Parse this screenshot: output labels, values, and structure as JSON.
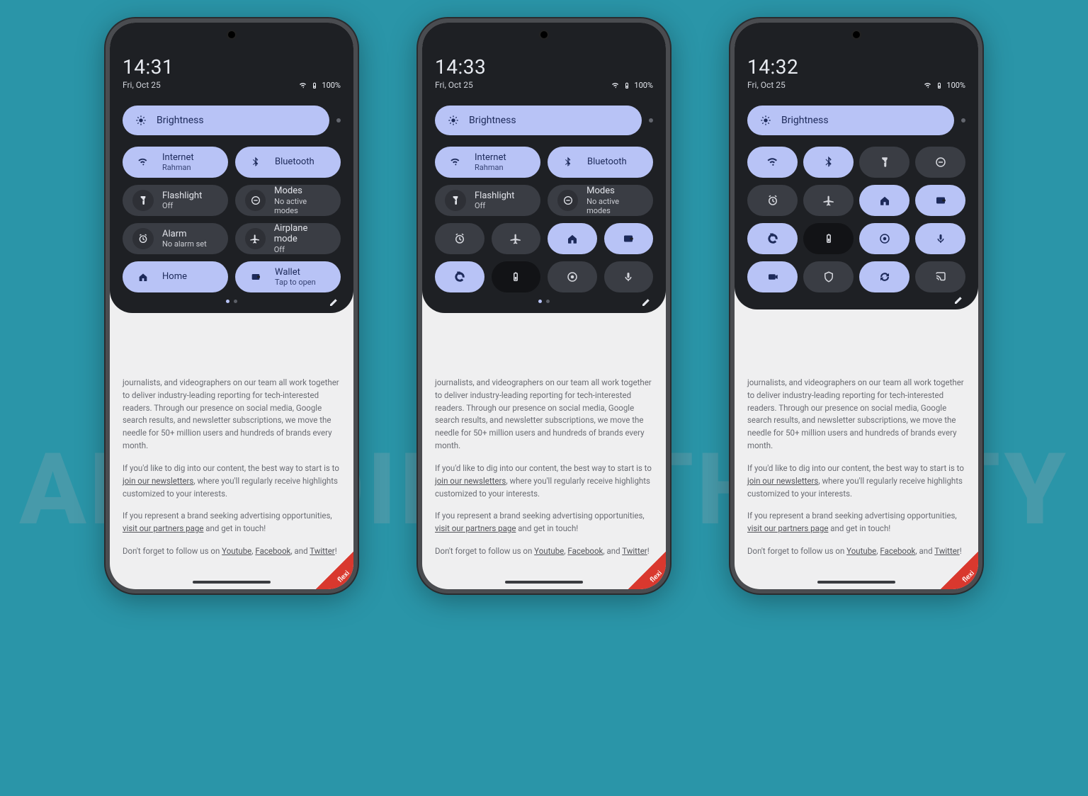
{
  "watermark": "ANDROID AUTHORITY",
  "corner_tag": "flexi",
  "status": {
    "battery": "100%"
  },
  "brightness_label": "Brightness",
  "article": {
    "p1_a": "journalists, and videographers on our team all work together to deliver industry-leading reporting for tech-interested readers. Through our presence on social media, Google search results, and newsletter subscriptions, we move the needle for 50+ million users and hundreds of brands every month.",
    "p2_a": "If you'd like to dig into our content, the best way to start is to ",
    "p2_link": "join our newsletters",
    "p2_b": ", where you'll regularly receive highlights customized to your interests.",
    "p3_a": "If you represent a brand seeking advertising opportunities, ",
    "p3_link": "visit our partners page",
    "p3_b": " and get in touch!",
    "p4_a": "Don't forget to follow us on ",
    "p4_y": "Youtube",
    "p4_s1": ", ",
    "p4_f": "Facebook",
    "p4_s2": ", and ",
    "p4_t": "Twitter",
    "p4_end": "!"
  },
  "phones": [
    {
      "time": "14:31",
      "date": "Fri, Oct 25",
      "layout": "wide",
      "tiles": [
        {
          "label": "Internet",
          "sub": "Rahman",
          "icon": "wifi",
          "state": "on"
        },
        {
          "label": "Bluetooth",
          "sub": "",
          "icon": "bluetooth",
          "state": "on"
        },
        {
          "label": "Flashlight",
          "sub": "Off",
          "icon": "flashlight",
          "state": "off"
        },
        {
          "label": "Modes",
          "sub": "No active modes",
          "icon": "dnd",
          "state": "off"
        },
        {
          "label": "Alarm",
          "sub": "No alarm set",
          "icon": "alarm",
          "state": "off"
        },
        {
          "label": "Airplane mode",
          "sub": "Off",
          "icon": "airplane",
          "state": "off"
        },
        {
          "label": "Home",
          "sub": "",
          "icon": "home",
          "state": "on"
        },
        {
          "label": "Wallet",
          "sub": "Tap to open",
          "icon": "wallet",
          "state": "on"
        }
      ],
      "page_active": 0
    },
    {
      "time": "14:33",
      "date": "Fri, Oct 25",
      "layout": "mixed",
      "wide_tiles": [
        {
          "label": "Internet",
          "sub": "Rahman",
          "icon": "wifi",
          "state": "on"
        },
        {
          "label": "Bluetooth",
          "sub": "",
          "icon": "bluetooth",
          "state": "on"
        },
        {
          "label": "Flashlight",
          "sub": "Off",
          "icon": "flashlight",
          "state": "off"
        },
        {
          "label": "Modes",
          "sub": "No active modes",
          "icon": "dnd",
          "state": "off"
        }
      ],
      "small_tiles": [
        {
          "icon": "alarm",
          "state": "off"
        },
        {
          "icon": "airplane",
          "state": "off"
        },
        {
          "icon": "home",
          "state": "on"
        },
        {
          "icon": "wallet",
          "state": "on"
        },
        {
          "icon": "rotate",
          "state": "on"
        },
        {
          "icon": "battery",
          "state": "dark"
        },
        {
          "icon": "record",
          "state": "off"
        },
        {
          "icon": "mic",
          "state": "off"
        }
      ],
      "page_active": 0
    },
    {
      "time": "14:32",
      "date": "Fri, Oct 25",
      "layout": "small",
      "small_tiles": [
        {
          "icon": "wifi",
          "state": "on"
        },
        {
          "icon": "bluetooth",
          "state": "on"
        },
        {
          "icon": "flashlight",
          "state": "off"
        },
        {
          "icon": "dnd",
          "state": "off"
        },
        {
          "icon": "alarm",
          "state": "off"
        },
        {
          "icon": "airplane",
          "state": "off"
        },
        {
          "icon": "home",
          "state": "on"
        },
        {
          "icon": "wallet",
          "state": "on"
        },
        {
          "icon": "rotate",
          "state": "on"
        },
        {
          "icon": "battery",
          "state": "dark"
        },
        {
          "icon": "record",
          "state": "on"
        },
        {
          "icon": "mic",
          "state": "on"
        },
        {
          "icon": "camera",
          "state": "on"
        },
        {
          "icon": "shield",
          "state": "off"
        },
        {
          "icon": "sync",
          "state": "on"
        },
        {
          "icon": "cast",
          "state": "off"
        }
      ]
    }
  ]
}
